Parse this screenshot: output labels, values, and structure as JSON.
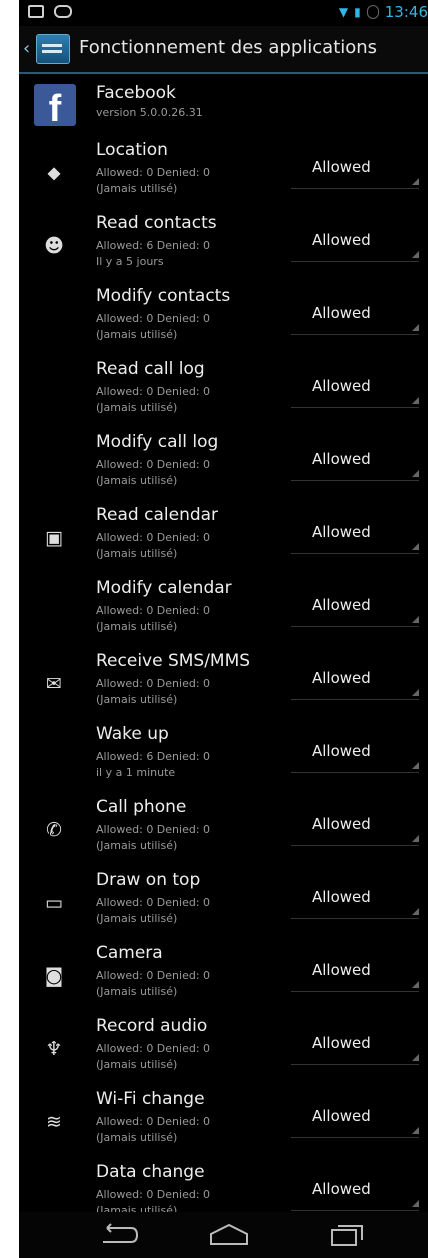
{
  "status_bar": {
    "time": "13:46"
  },
  "action_bar": {
    "title": "Fonctionnement des applications"
  },
  "app": {
    "name": "Facebook",
    "version": "version 5.0.0.26.31"
  },
  "permissions": [
    {
      "name": "Location",
      "counts": "Allowed: 0 Denied: 0",
      "last_used": "(Jamais utilisé)",
      "value": "Allowed",
      "icon": "location-pin-icon"
    },
    {
      "name": "Read contacts",
      "counts": "Allowed: 6 Denied: 0",
      "last_used": "Il y a 5 jours",
      "value": "Allowed",
      "icon": "contacts-icon"
    },
    {
      "name": "Modify contacts",
      "counts": "Allowed: 0 Denied: 0",
      "last_used": "(Jamais utilisé)",
      "value": "Allowed",
      "icon": ""
    },
    {
      "name": "Read call log",
      "counts": "Allowed: 0 Denied: 0",
      "last_used": "(Jamais utilisé)",
      "value": "Allowed",
      "icon": ""
    },
    {
      "name": "Modify call log",
      "counts": "Allowed: 0 Denied: 0",
      "last_used": "(Jamais utilisé)",
      "value": "Allowed",
      "icon": ""
    },
    {
      "name": "Read calendar",
      "counts": "Allowed: 0 Denied: 0",
      "last_used": "(Jamais utilisé)",
      "value": "Allowed",
      "icon": "calendar-icon"
    },
    {
      "name": "Modify calendar",
      "counts": "Allowed: 0 Denied: 0",
      "last_used": "(Jamais utilisé)",
      "value": "Allowed",
      "icon": ""
    },
    {
      "name": "Receive SMS/MMS",
      "counts": "Allowed: 0 Denied: 0",
      "last_used": "(Jamais utilisé)",
      "value": "Allowed",
      "icon": "message-icon"
    },
    {
      "name": "Wake up",
      "counts": "Allowed: 6 Denied: 0",
      "last_used": "il y a 1 minute",
      "value": "Allowed",
      "icon": ""
    },
    {
      "name": "Call phone",
      "counts": "Allowed: 0 Denied: 0",
      "last_used": "(Jamais utilisé)",
      "value": "Allowed",
      "icon": "phone-icon"
    },
    {
      "name": "Draw on top",
      "counts": "Allowed: 0 Denied: 0",
      "last_used": "(Jamais utilisé)",
      "value": "Allowed",
      "icon": "overlay-icon"
    },
    {
      "name": "Camera",
      "counts": "Allowed: 0 Denied: 0",
      "last_used": "(Jamais utilisé)",
      "value": "Allowed",
      "icon": "camera-icon"
    },
    {
      "name": "Record audio",
      "counts": "Allowed: 0 Denied: 0",
      "last_used": "(Jamais utilisé)",
      "value": "Allowed",
      "icon": "microphone-icon"
    },
    {
      "name": "Wi-Fi change",
      "counts": "Allowed: 0 Denied: 0",
      "last_used": "(Jamais utilisé)",
      "value": "Allowed",
      "icon": "wifi-icon"
    },
    {
      "name": "Data change",
      "counts": "Allowed: 0 Denied: 0",
      "last_used": "(Jamais utilisé)",
      "value": "Allowed",
      "icon": ""
    }
  ],
  "colors": {
    "accent": "#33b5e5",
    "background": "#000000",
    "facebook": "#3b5998"
  }
}
